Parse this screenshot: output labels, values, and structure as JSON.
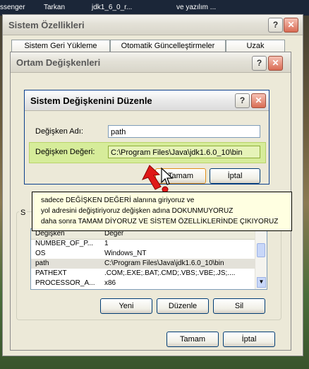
{
  "desktop": {
    "top_items": [
      "ssenger",
      "Tarkan",
      "jdk1_6_0_r...",
      "ve yazılım ..."
    ]
  },
  "sys_props": {
    "title": "Sistem Özellikleri",
    "tabs": [
      "Sistem Geri Yükleme",
      "Otomatik Güncelleştirmeler",
      "Uzak"
    ],
    "help": "?",
    "close": "✕",
    "ok_label": "Tamam",
    "cancel_label": "İptal"
  },
  "env_vars": {
    "title": "Ortam Değişkenleri",
    "help": "?",
    "close": "✕",
    "group_label": "S",
    "columns": [
      "Değişken",
      "Değer"
    ],
    "rows": [
      {
        "name": "NUMBER_OF_P...",
        "value": "1"
      },
      {
        "name": "OS",
        "value": "Windows_NT"
      },
      {
        "name": "path",
        "value": "C:\\Program Files\\Java\\jdk1.6.0_10\\bin"
      },
      {
        "name": "PATHEXT",
        "value": ".COM;.EXE;.BAT;.CMD;.VBS;.VBE;.JS;...."
      },
      {
        "name": "PROCESSOR_A...",
        "value": "x86"
      }
    ],
    "new_label": "Yeni",
    "edit_label": "Düzenle",
    "delete_label": "Sil"
  },
  "edit_dialog": {
    "title": "Sistem Değişkenini Düzenle",
    "help": "?",
    "close": "✕",
    "name_label": "Değişken Adı:",
    "name_value": "path",
    "value_label": "Değişken Değeri:",
    "value_value": "C:\\Program Files\\Java\\jdk1.6.0_10\\bin",
    "ok_label": "Tamam",
    "cancel_label": "İptal"
  },
  "callout": {
    "line1": "sadece DEĞİŞKEN DEĞERİ alanına giriyoruz ve",
    "line2": "yol adresini değiştiriyoruz değişken adına DOKUNMUYORUZ",
    "line3": "daha sonra TAMAM DİYORUZ VE SİSTEM ÖZELLİKLERİNDE ÇIKIYORUZ"
  },
  "colors": {
    "highlight_bg": "#d6ec9a",
    "arrow": "#e01818",
    "callout_bg": "#ffffe1"
  }
}
